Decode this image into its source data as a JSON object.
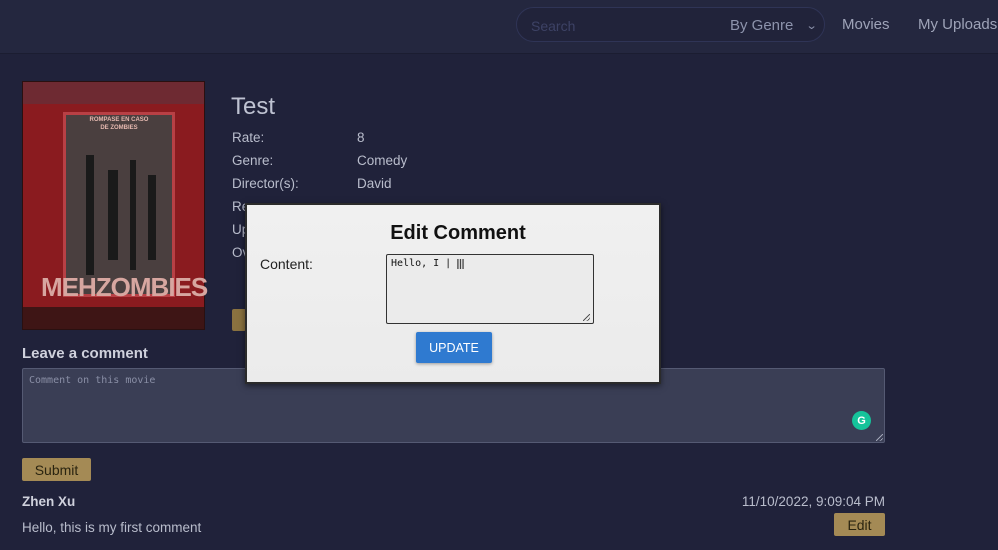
{
  "header": {
    "search_placeholder": "Search",
    "genre_select": "By Genre",
    "nav": {
      "movies": "Movies",
      "uploads": "My Uploads"
    }
  },
  "poster": {
    "label_line1": "ROMPASE EN CASO",
    "label_line2": "DE ZOMBIES",
    "title": "MEHZOMBIES"
  },
  "movie": {
    "title": "Test",
    "fields": [
      {
        "label": "Rate:",
        "value": "8"
      },
      {
        "label": "Genre:",
        "value": "Comedy"
      },
      {
        "label": "Director(s):",
        "value": "David"
      },
      {
        "label": "Re",
        "value": ""
      },
      {
        "label": "Up",
        "value": ""
      },
      {
        "label": "Ov",
        "value": ""
      }
    ]
  },
  "comment_form": {
    "heading": "Leave a comment",
    "placeholder": "Comment on this movie",
    "grammar_icon_text": "G",
    "submit_label": "Submit"
  },
  "comments": [
    {
      "author": "Zhen Xu",
      "date": "11/10/2022, 9:09:04 PM",
      "text": "Hello, this is my first comment",
      "edit_label": "Edit"
    }
  ],
  "modal": {
    "title": "Edit Comment",
    "content_label": "Content:",
    "content_value": "Hello, I |",
    "update_label": "UPDATE"
  }
}
